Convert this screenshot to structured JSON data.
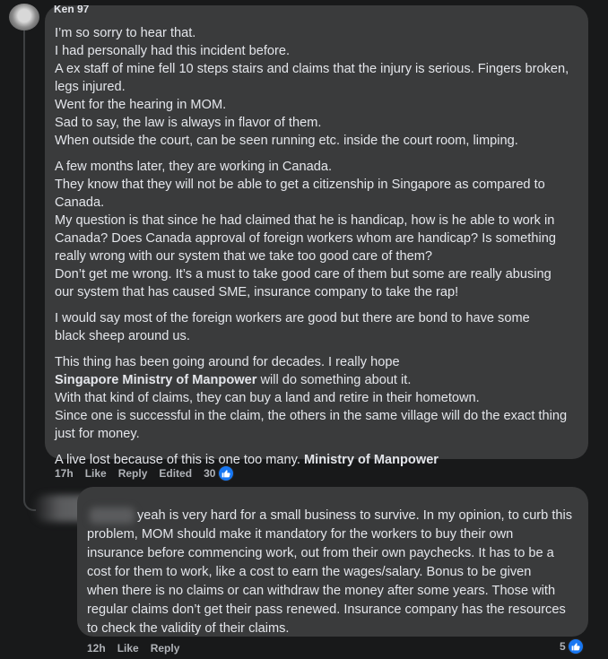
{
  "comment1": {
    "author_partial": "Ken 97",
    "paragraphs": [
      [
        "I’m so sorry to hear that.",
        "I had personally had this incident before.",
        "A ex staff of mine fell 10 steps stairs and claims that the injury is serious. Fingers broken,",
        "legs injured.",
        "Went for the hearing in MOM.",
        "Sad to say, the law is always in flavor of them.",
        "When outside the court, can be seen running etc. inside the court room, limping."
      ],
      [
        "A few months later, they are working in Canada.",
        "They know that they will not be able to get a citizenship in Singapore as compared to",
        "Canada.",
        "My question is that since he had claimed that he is handicap, how is he able to work in",
        "Canada? Does Canada approval of foreign workers whom are handicap? Is something",
        "really wrong with our system that we take too good care of them?",
        "Don’t get me wrong. It’s a must to take good care of them but some are really abusing",
        "our system that has caused SME, insurance company to take the rap!"
      ],
      [
        "I would say most of the foreign workers are good but there are bond to have some",
        "black sheep around us."
      ]
    ],
    "p4_line1": "This thing has been going around for decades. I really hope",
    "p4_mention": "Singapore Ministry of Manpower",
    "p4_line2_rest": " will do something about it.",
    "p4_lines_after": [
      "With that kind of claims, they can buy a land and retire in their hometown.",
      "Since one is successful in the claim, the others in the same village will do the exact thing",
      "just for money."
    ],
    "p5_text": "A live lost because of this is one too many. ",
    "p5_mention": "Ministry of Manpower",
    "meta": {
      "time": "17h",
      "like": "Like",
      "reply": "Reply",
      "edited": "Edited",
      "reactions": "30"
    }
  },
  "comment2": {
    "lines": [
      "yeah is very hard for a small business to survive. In my opinion, to curb this",
      "problem, MOM should make it mandatory for the workers to buy their own",
      "insurance before commencing work, out from their own paychecks. It has to be a",
      "cost for them to work, like a cost to earn the wages/salary. Bonus to be given",
      "when there is no claims or can withdraw the money after some years. Those with",
      "regular claims don’t get their pass renewed. Insurance company has the resources",
      "to check the validity of their claims."
    ],
    "meta": {
      "time": "12h",
      "like": "Like",
      "reply": "Reply",
      "reactions": "5"
    }
  },
  "colors": {
    "background": "#18191a",
    "bubble": "#3a3b3c",
    "text": "#e4e6eb",
    "meta": "#b0b3b8",
    "like_blue": "#1877f2"
  },
  "icons": [
    "like-reaction-icon",
    "avatar"
  ]
}
